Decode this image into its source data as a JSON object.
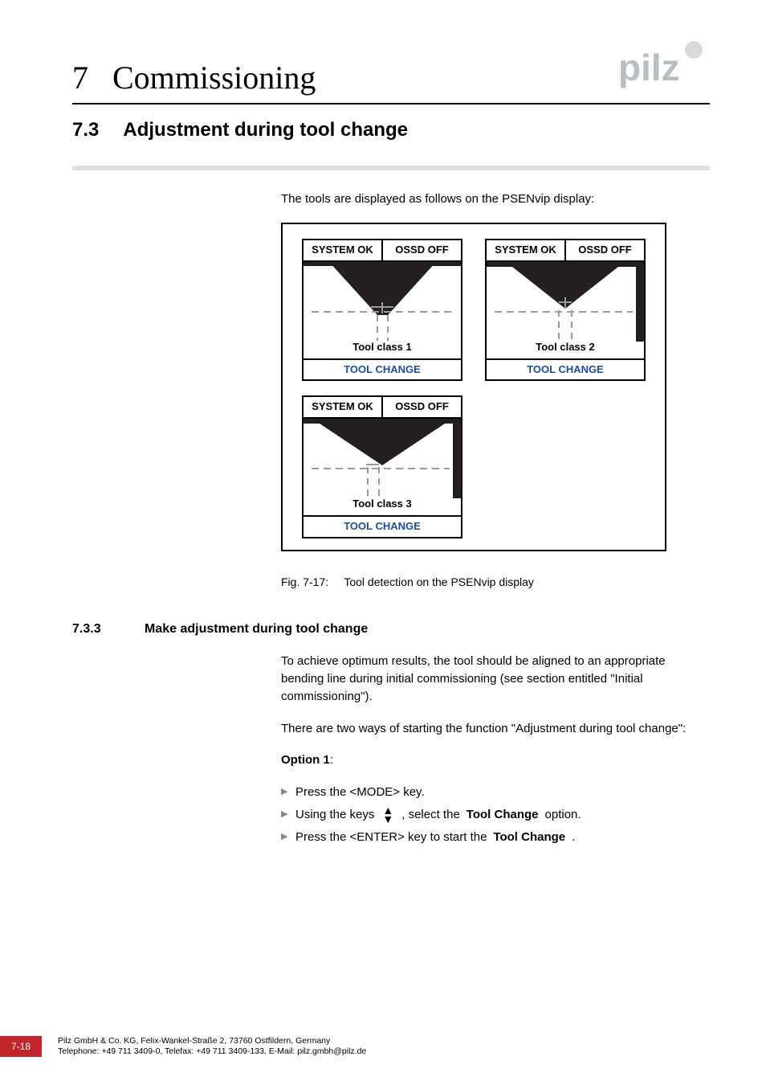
{
  "header": {
    "chapter_number": "7",
    "chapter_title": "Commissioning",
    "logo_alt": "pilz"
  },
  "section": {
    "number": "7.3",
    "title": "Adjustment during tool change"
  },
  "intro": "The tools are displayed as follows on the PSENvip display:",
  "displays": {
    "system_ok": "SYSTEM OK",
    "ossd_off": "OSSD OFF",
    "tool_change": "TOOL CHANGE",
    "class1": "Tool class 1",
    "class2": "Tool class 2",
    "class3": "Tool class 3"
  },
  "figure": {
    "label": "Fig. 7-17:",
    "caption": "Tool detection on the PSENvip display"
  },
  "subsection": {
    "number": "7.3.3",
    "title": "Make adjustment during tool change"
  },
  "para1": "To achieve optimum results, the tool should be aligned to an appropriate bending line during initial commissioning (see section entitled \"Initial commissioning\").",
  "para2": "There are two ways of starting the function \"Adjustment during tool change\":",
  "option1_label": "Option 1",
  "bullets": {
    "b1": "Press the <MODE> key.",
    "b2a": "Using the keys",
    "b2b": ", select the ",
    "b2c": "Tool Change",
    "b2d": " option.",
    "b3a": "Press the <ENTER> key to start the ",
    "b3b": "Tool Change",
    "b3c": "."
  },
  "footer": {
    "page": "7-18",
    "line1": "Pilz GmbH & Co. KG, Felix-Wankel-Straße 2, 73760 Ostfildern, Germany",
    "line2": "Telephone: +49 711 3409-0, Telefax: +49 711 3409-133, E-Mail: pilz.gmbh@pilz.de"
  }
}
